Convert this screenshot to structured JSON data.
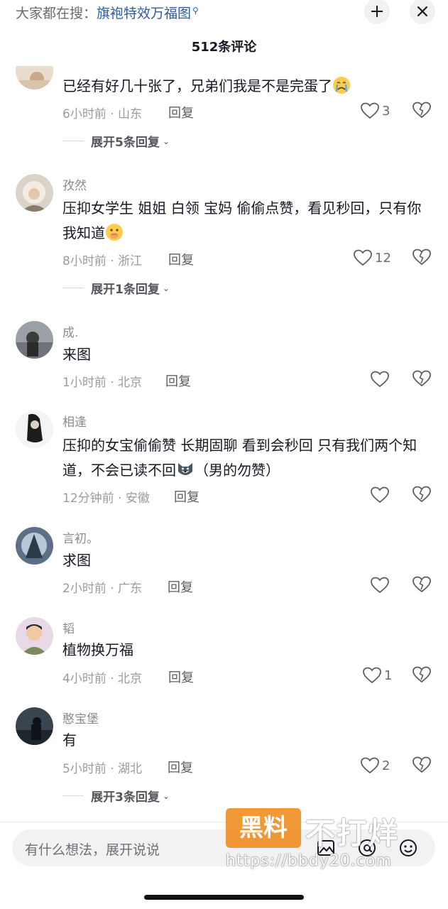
{
  "header": {
    "search_prefix": "大家都在搜：",
    "search_keyword": "旗袍特效万福图",
    "comment_count_title": "512条评论"
  },
  "comments": [
    {
      "username": "",
      "text": "已经有好几十张了，兄弟们我是不是完蛋了",
      "emoji": "crying-face",
      "meta": "6小时前 · 山东",
      "reply_label": "回复",
      "likes": "3",
      "expand_label": "展开5条回复"
    },
    {
      "username": "孜然",
      "text": "压抑女学生 姐姐 白领 宝妈 偷偷点赞，看见秒回，只有你我知道",
      "emoji": "shushing-face",
      "meta": "8小时前 · 浙江",
      "reply_label": "回复",
      "likes": "12",
      "expand_label": "展开1条回复"
    },
    {
      "username": "成.",
      "text": "来图",
      "meta": "1小时前 · 北京",
      "reply_label": "回复",
      "likes": ""
    },
    {
      "username": "相逢",
      "text": "压抑的女宝偷偷赞   长期固聊  看到会秒回 只有我们两个知道，不会已读不回",
      "text_suffix": "（男的勿赞）",
      "emoji": "husky-dog",
      "meta": "12分钟前 · 安徽",
      "reply_label": "回复",
      "likes": ""
    },
    {
      "username": "言初。",
      "text": "求图",
      "meta": "2小时前 · 广东",
      "reply_label": "回复",
      "likes": ""
    },
    {
      "username": "韬",
      "text": "植物换万福",
      "meta": "4小时前 · 北京",
      "reply_label": "回复",
      "likes": "1"
    },
    {
      "username": "憨宝堡",
      "text": "有",
      "meta": "5小时前 · 湖北",
      "reply_label": "回复",
      "likes": "2",
      "expand_label": "展开3条回复"
    }
  ],
  "composer": {
    "placeholder": "有什么想法，展开说说",
    "icons": [
      "image-icon",
      "at-icon",
      "emoji-icon"
    ]
  },
  "watermark": {
    "badge": "黑料",
    "title": "不打烊",
    "url": "https://bbdy20.com"
  },
  "colors": {
    "keyword_blue": "#2d5aa6",
    "secondary_text": "#9a9ba1",
    "watermark_orange": "#f08a1e"
  }
}
